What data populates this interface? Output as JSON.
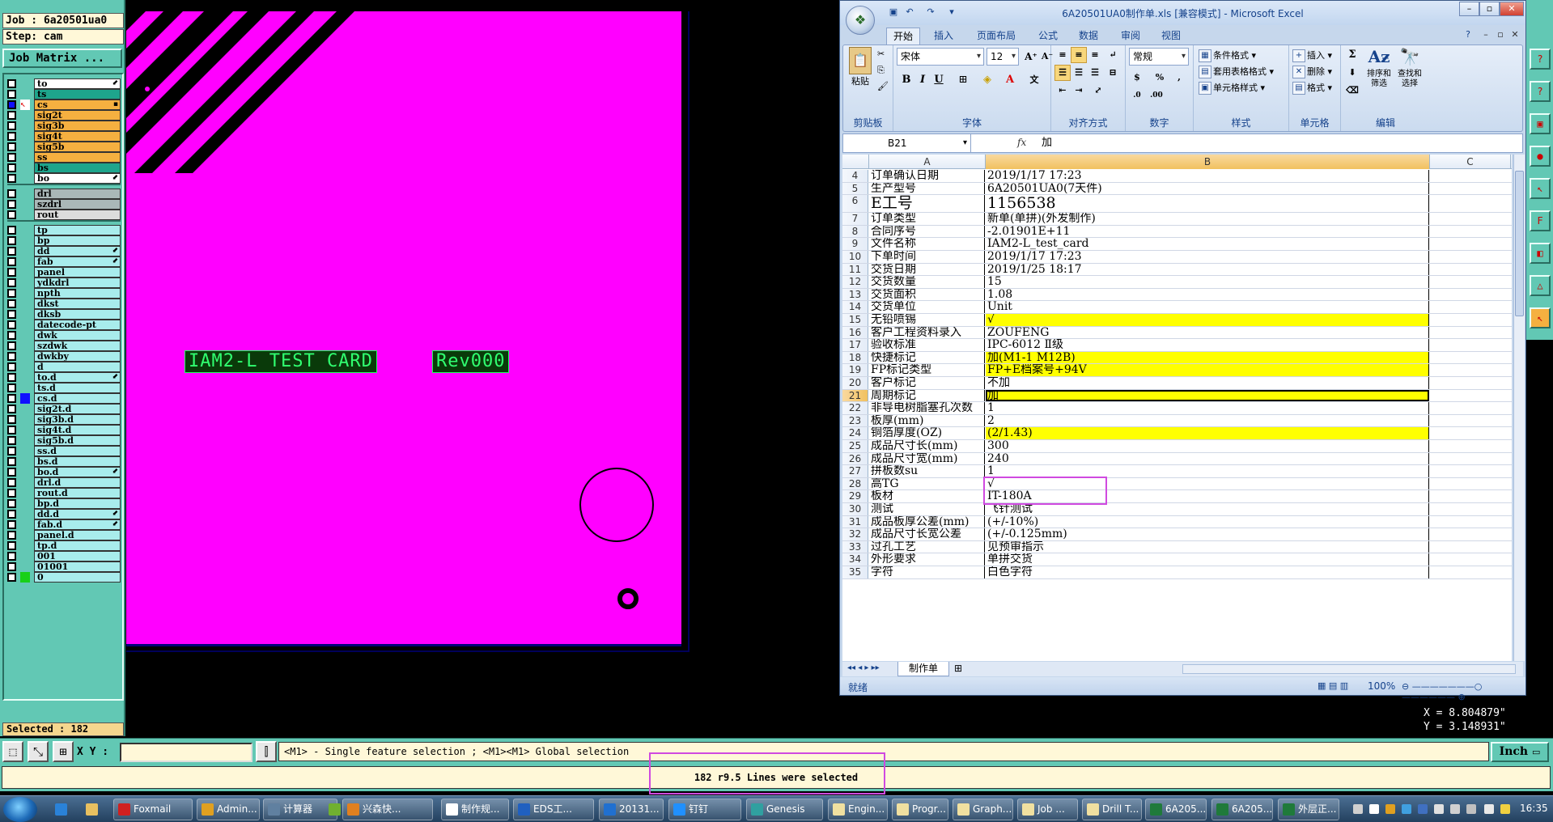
{
  "genesis": {
    "job_label": "Job : 6a20501ua0",
    "step_label": "Step: cam",
    "job_matrix_label": "Job Matrix ...",
    "selected_label": "Selected : 182",
    "layers_group1": [
      {
        "name": "to",
        "color": "#ffffff",
        "flag": "⬋"
      },
      {
        "name": "ts",
        "color": "#1ea58c",
        "flag": ""
      },
      {
        "name": "cs",
        "color": "#f5b040",
        "flag": "▪",
        "active": true
      },
      {
        "name": "sig2t",
        "color": "#f5b040",
        "flag": ""
      },
      {
        "name": "sig3b",
        "color": "#f5b040",
        "flag": ""
      },
      {
        "name": "sig4t",
        "color": "#f5b040",
        "flag": ""
      },
      {
        "name": "sig5b",
        "color": "#f5b040",
        "flag": ""
      },
      {
        "name": "ss",
        "color": "#f5b040",
        "flag": ""
      },
      {
        "name": "bs",
        "color": "#1ea58c",
        "flag": ""
      },
      {
        "name": "bo",
        "color": "#ffffff",
        "flag": "⬋"
      }
    ],
    "layers_group2": [
      {
        "name": "drl",
        "color": "#aab8b8"
      },
      {
        "name": "szdrl",
        "color": "#aab8b8"
      },
      {
        "name": "rout",
        "color": "#dcdcdc"
      }
    ],
    "layers_group3": [
      {
        "name": "tp",
        "flag": ""
      },
      {
        "name": "bp",
        "flag": ""
      },
      {
        "name": "dd",
        "flag": "⬋"
      },
      {
        "name": "fab",
        "flag": "⬋"
      },
      {
        "name": "panel",
        "flag": ""
      },
      {
        "name": "ydkdrl",
        "flag": ""
      },
      {
        "name": "npth",
        "flag": ""
      },
      {
        "name": "dkst",
        "flag": ""
      },
      {
        "name": "dksb",
        "flag": ""
      },
      {
        "name": "datecode-pt",
        "flag": ""
      },
      {
        "name": "dwk",
        "flag": ""
      },
      {
        "name": "szdwk",
        "flag": ""
      },
      {
        "name": "dwkby",
        "flag": ""
      },
      {
        "name": "d",
        "flag": ""
      },
      {
        "name": "to.d",
        "flag": "⬋"
      },
      {
        "name": "ts.d",
        "flag": ""
      },
      {
        "name": "cs.d",
        "flag": "",
        "mark": "#1010ff"
      },
      {
        "name": "sig2t.d",
        "flag": ""
      },
      {
        "name": "sig3b.d",
        "flag": ""
      },
      {
        "name": "sig4t.d",
        "flag": ""
      },
      {
        "name": "sig5b.d",
        "flag": ""
      },
      {
        "name": "ss.d",
        "flag": ""
      },
      {
        "name": "bs.d",
        "flag": ""
      },
      {
        "name": "bo.d",
        "flag": "⬋"
      },
      {
        "name": "drl.d",
        "flag": ""
      },
      {
        "name": "rout.d",
        "flag": ""
      },
      {
        "name": "bp.d",
        "flag": ""
      },
      {
        "name": "dd.d",
        "flag": "⬋"
      },
      {
        "name": "fab.d",
        "flag": "⬋"
      },
      {
        "name": "panel.d",
        "flag": ""
      },
      {
        "name": "tp.d",
        "flag": ""
      },
      {
        "name": "001",
        "flag": ""
      },
      {
        "name": "01001",
        "flag": ""
      },
      {
        "name": "0",
        "flag": "",
        "mark": "#18d018"
      }
    ],
    "silk_text_1": "IAM2-L TEST CARD",
    "silk_text_2": "Rev000",
    "coord_x": "X = 8.804879\"",
    "coord_y": "Y = 3.148931\"",
    "xy_label": "X Y :",
    "xy_value": "",
    "hint_text": "<M1> - Single feature selection ; <M1><M1> Global selection",
    "units_button": "Inch",
    "status_text": "182 r9.5 Lines were selected"
  },
  "excel": {
    "title": "6A20501UA0制作单.xls [兼容模式] - Microsoft Excel",
    "tabs": [
      "开始",
      "插入",
      "页面布局",
      "公式",
      "数据",
      "审阅",
      "视图"
    ],
    "active_tab": "开始",
    "groups": {
      "clipboard": "剪贴板",
      "font": "字体",
      "align": "对齐方式",
      "number": "数字",
      "style": "样式",
      "cells": "单元格",
      "edit": "编辑"
    },
    "paste_label": "粘贴",
    "font_name": "宋体",
    "font_size": "12",
    "number_format": "常规",
    "style_buttons": [
      "条件格式",
      "套用表格格式",
      "单元格样式"
    ],
    "cell_buttons": [
      "插入",
      "删除",
      "格式"
    ],
    "edit_buttons": [
      "排序和筛选",
      "查找和选择"
    ],
    "name_box": "B21",
    "formula": "加",
    "columns": [
      "A",
      "B",
      "C"
    ],
    "rows": [
      {
        "n": "4",
        "a": "订单确认日期",
        "b": "2019/1/17 17:23",
        "y": false
      },
      {
        "n": "5",
        "a": "生产型号",
        "b": "6A20501UA0(7天件)",
        "y": false
      },
      {
        "n": "6",
        "a": "E工号",
        "b": "1156538",
        "y": false,
        "big": true
      },
      {
        "n": "7",
        "a": "订单类型",
        "b": "新单(单拼)(外发制作)",
        "y": false
      },
      {
        "n": "8",
        "a": "合同序号",
        "b": "-2.01901E+11",
        "y": false
      },
      {
        "n": "9",
        "a": "文件名称",
        "b": "IAM2-L_test_card",
        "y": false
      },
      {
        "n": "10",
        "a": "下单时间",
        "b": "2019/1/17 17:23",
        "y": false
      },
      {
        "n": "11",
        "a": "交货日期",
        "b": "2019/1/25 18:17",
        "y": false
      },
      {
        "n": "12",
        "a": "交货数量",
        "b": "15",
        "y": false
      },
      {
        "n": "13",
        "a": "交货面积",
        "b": "1.08",
        "y": false
      },
      {
        "n": "14",
        "a": "交货单位",
        "b": "Unit",
        "y": false
      },
      {
        "n": "15",
        "a": "无铅喷锡",
        "b": "√",
        "y": true
      },
      {
        "n": "16",
        "a": "客户工程资料录入",
        "b": "ZOUFENG",
        "y": false
      },
      {
        "n": "17",
        "a": "验收标准",
        "b": "IPC-6012 Ⅱ级",
        "y": false
      },
      {
        "n": "18",
        "a": "快捷标记",
        "b": "加(M1-1 M12B)",
        "y": true
      },
      {
        "n": "19",
        "a": "FP标记类型",
        "b": "FP+E档案号+94V",
        "y": true
      },
      {
        "n": "20",
        "a": "客户标记",
        "b": "不加",
        "y": false
      },
      {
        "n": "21",
        "a": "周期标记",
        "b": "加",
        "y": true,
        "sel": true
      },
      {
        "n": "22",
        "a": "非导电树脂塞孔次数",
        "b": "1",
        "y": false
      },
      {
        "n": "23",
        "a": "板厚(mm)",
        "b": "2",
        "y": false
      },
      {
        "n": "24",
        "a": "铜箔厚度(OZ)",
        "b": "(2/1.43)",
        "y": true
      },
      {
        "n": "25",
        "a": "成品尺寸长(mm)",
        "b": "300",
        "y": false
      },
      {
        "n": "26",
        "a": "成品尺寸宽(mm)",
        "b": "240",
        "y": false
      },
      {
        "n": "27",
        "a": "拼板数su",
        "b": "1",
        "y": false
      },
      {
        "n": "28",
        "a": "高TG",
        "b": "√",
        "y": false
      },
      {
        "n": "29",
        "a": "板材",
        "b": "IT-180A",
        "y": false
      },
      {
        "n": "30",
        "a": "测试",
        "b": "飞针测试",
        "y": false
      },
      {
        "n": "31",
        "a": "成品板厚公差(mm)",
        "b": "(+/-10%)",
        "y": false
      },
      {
        "n": "32",
        "a": "成品尺寸长宽公差",
        "b": "(+/-0.125mm)",
        "y": false
      },
      {
        "n": "33",
        "a": "过孔工艺",
        "b": "见预审指示",
        "y": false
      },
      {
        "n": "34",
        "a": "外形要求",
        "b": "单拼交货",
        "y": false
      },
      {
        "n": "35",
        "a": "字符",
        "b": "白色字符",
        "y": false
      }
    ],
    "sheet_tab": "制作单",
    "status": "就绪",
    "zoom": "100%"
  },
  "taskbar": {
    "items": [
      {
        "label": "Foxmail",
        "color": "#d02020"
      },
      {
        "label": "Admin...",
        "color": "#e0a020"
      },
      {
        "label": "计算器",
        "color": "#6080a0"
      },
      {
        "label": "兴森快...",
        "color": "#e08020"
      },
      {
        "label": "制作规...",
        "color": "#ffffff"
      },
      {
        "label": "EDS工...",
        "color": "#2060c0"
      },
      {
        "label": "20131...",
        "color": "#2070d0"
      },
      {
        "label": "钉钉",
        "color": "#2090ff"
      },
      {
        "label": "Genesis",
        "color": "#30a0a0"
      },
      {
        "label": "Engin...",
        "color": "#f0e0a0"
      },
      {
        "label": "Progr...",
        "color": "#f0e0a0"
      },
      {
        "label": "Graph...",
        "color": "#f0e0a0"
      },
      {
        "label": "Job ...",
        "color": "#f0e0a0"
      },
      {
        "label": "Drill T...",
        "color": "#f0e0a0"
      },
      {
        "label": "6A205...",
        "color": "#1f7a3a"
      },
      {
        "label": "6A205...",
        "color": "#1f7a3a"
      },
      {
        "label": "外层正...",
        "color": "#1f7a3a"
      }
    ],
    "clock": "16:35"
  }
}
